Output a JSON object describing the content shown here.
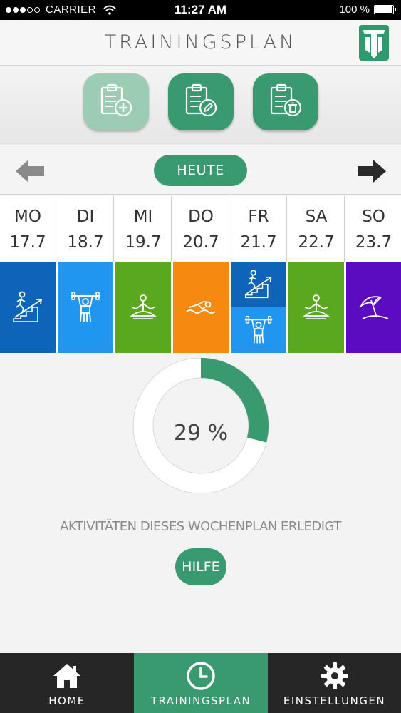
{
  "status_bar": {
    "carrier": "CARRIER",
    "time": "11:27 AM",
    "battery": "100 %"
  },
  "header": {
    "title": "TRAININGSPLAN",
    "logo_icon": "university-logo-icon"
  },
  "actions": [
    {
      "icon": "clipboard-add-icon",
      "enabled": false
    },
    {
      "icon": "clipboard-edit-icon",
      "enabled": true
    },
    {
      "icon": "clipboard-delete-icon",
      "enabled": true
    }
  ],
  "nav": {
    "today_label": "HEUTE",
    "prev_icon": "arrow-left-icon",
    "next_icon": "arrow-right-icon"
  },
  "days": [
    {
      "name": "MO",
      "date": "17.7",
      "activities": [
        {
          "icon": "running-progress-icon",
          "color": "#0d64b8"
        }
      ]
    },
    {
      "name": "DI",
      "date": "18.7",
      "activities": [
        {
          "icon": "weightlifting-icon",
          "color": "#2096f0"
        }
      ]
    },
    {
      "name": "MI",
      "date": "19.7",
      "activities": [
        {
          "icon": "yoga-icon",
          "color": "#5aa820"
        }
      ]
    },
    {
      "name": "DO",
      "date": "20.7",
      "activities": [
        {
          "icon": "swimming-icon",
          "color": "#f68a10"
        }
      ]
    },
    {
      "name": "FR",
      "date": "21.7",
      "activities": [
        {
          "icon": "running-progress-icon",
          "color": "#0d64b8"
        },
        {
          "icon": "weightlifting-icon",
          "color": "#2096f0"
        }
      ]
    },
    {
      "name": "SA",
      "date": "22.7",
      "activities": [
        {
          "icon": "yoga-icon",
          "color": "#5aa820"
        }
      ]
    },
    {
      "name": "SO",
      "date": "23.7",
      "activities": [
        {
          "icon": "beach-umbrella-icon",
          "color": "#5b0cc0"
        }
      ]
    }
  ],
  "progress": {
    "percent": 29,
    "percent_label": "29 %",
    "label": "AKTIVITÄTEN DIESES WOCHENPLAN ERLEDIGT",
    "color": "#3a9a6f"
  },
  "help_label": "HILFE",
  "tabs": [
    {
      "label": "HOME",
      "icon": "home-icon",
      "active": false
    },
    {
      "label": "TRAININGSPLAN",
      "icon": "clock-icon",
      "active": true
    },
    {
      "label": "EINSTELLUNGEN",
      "icon": "gear-icon",
      "active": false
    }
  ],
  "colors": {
    "accent": "#3a9a6f",
    "tabbar": "#262626"
  }
}
